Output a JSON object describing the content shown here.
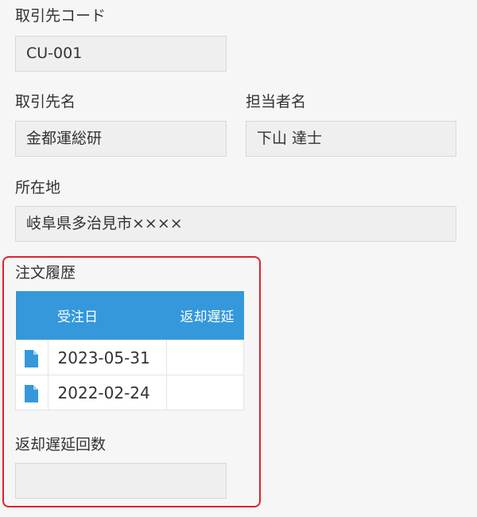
{
  "customer_code": {
    "label": "取引先コード",
    "value": "CU-001"
  },
  "customer_name": {
    "label": "取引先名",
    "value": "金都運総研"
  },
  "contact_name": {
    "label": "担当者名",
    "value": "下山 達士"
  },
  "address": {
    "label": "所在地",
    "value": "岐阜県多治見市××××"
  },
  "order_history": {
    "label": "注文履歴",
    "columns": [
      "",
      "受注日",
      "返却遅延"
    ],
    "rows": [
      {
        "icon": "document-icon",
        "order_date": "2023-05-31",
        "return_delay": ""
      },
      {
        "icon": "document-icon",
        "order_date": "2022-02-24",
        "return_delay": ""
      }
    ]
  },
  "return_delay_count": {
    "label": "返却遅延回数",
    "value": ""
  },
  "colors": {
    "accent": "#3498db",
    "highlight_border": "#e0222c",
    "field_background": "#efefef"
  }
}
